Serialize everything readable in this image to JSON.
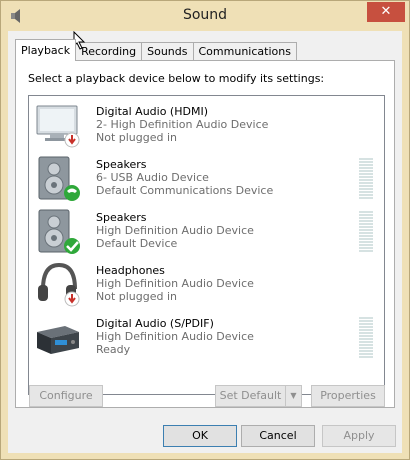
{
  "window": {
    "title": "Sound",
    "close_glyph": "✕"
  },
  "tabs": [
    {
      "label": "Playback",
      "active": true
    },
    {
      "label": "Recording",
      "active": false
    },
    {
      "label": "Sounds",
      "active": false
    },
    {
      "label": "Communications",
      "active": false
    }
  ],
  "instructions": "Select a playback device below to modify its settings:",
  "devices": [
    {
      "name": "Digital Audio (HDMI)",
      "line2": "2- High Definition Audio Device",
      "line3": "Not plugged in",
      "icon": "monitor-icon",
      "badge": "unplugged-badge-icon",
      "meter": false
    },
    {
      "name": "Speakers",
      "line2": "6- USB Audio Device",
      "line3": "Default Communications Device",
      "icon": "speaker-icon",
      "badge": "phone-badge-icon",
      "meter": true
    },
    {
      "name": "Speakers",
      "line2": "High Definition Audio Device",
      "line3": "Default Device",
      "icon": "speaker-icon",
      "badge": "checkmark-badge-icon",
      "meter": true
    },
    {
      "name": "Headphones",
      "line2": "High Definition Audio Device",
      "line3": "Not plugged in",
      "icon": "headphones-icon",
      "badge": "unplugged-badge-icon",
      "meter": false
    },
    {
      "name": "Digital Audio (S/PDIF)",
      "line2": "High Definition Audio Device",
      "line3": "Ready",
      "icon": "digital-receiver-icon",
      "badge": "",
      "meter": true
    }
  ],
  "buttons": {
    "configure": "Configure",
    "set_default": "Set Default",
    "properties": "Properties",
    "ok": "OK",
    "cancel": "Cancel",
    "apply": "Apply"
  },
  "colors": {
    "titlebar": "#efe0b6",
    "close_button": "#c7503f",
    "check_green": "#2fa83a",
    "unplugged_red": "#c8312a"
  }
}
